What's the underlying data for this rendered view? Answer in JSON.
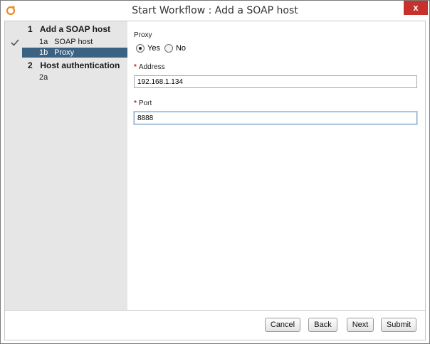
{
  "window": {
    "title": "Start Workflow : Add a SOAP host",
    "close_label": "x"
  },
  "sidebar": {
    "steps": [
      {
        "num": "1",
        "title": "Add a SOAP host",
        "substeps": [
          {
            "code": "1a",
            "label": "SOAP host"
          },
          {
            "code": "1b",
            "label": "Proxy"
          }
        ]
      },
      {
        "num": "2",
        "title": "Host authentication",
        "substeps": [
          {
            "code": "2a",
            "label": ""
          }
        ]
      }
    ]
  },
  "form": {
    "proxy": {
      "label": "Proxy",
      "options": [
        "Yes",
        "No"
      ],
      "selected": "Yes"
    },
    "address": {
      "label": "Address",
      "value": "192.168.1.134"
    },
    "port": {
      "label": "Port",
      "value": "8888"
    }
  },
  "buttons": {
    "cancel": "Cancel",
    "back": "Back",
    "next": "Next",
    "submit": "Submit"
  }
}
